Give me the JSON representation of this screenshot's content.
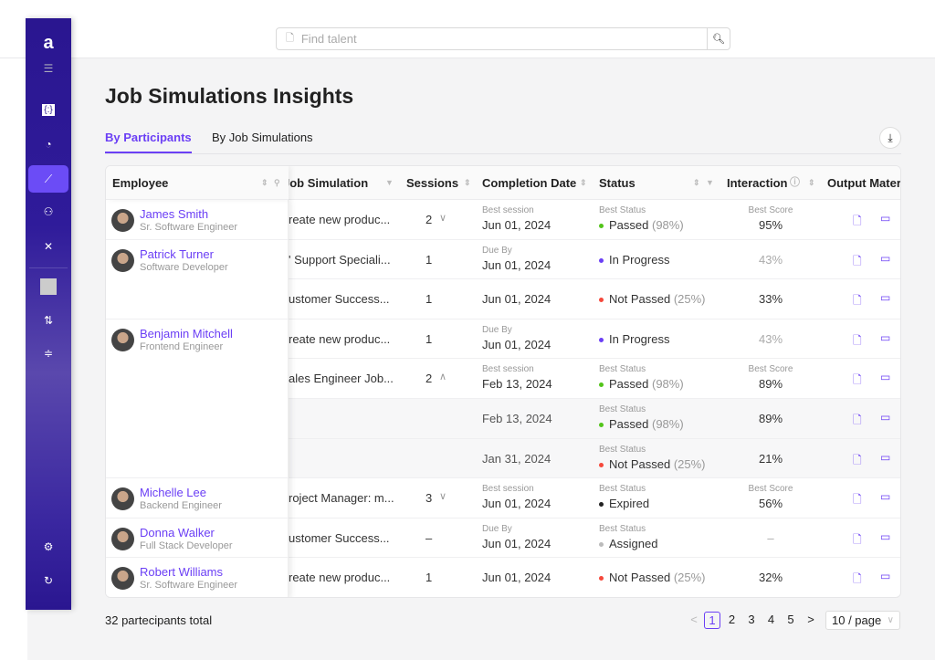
{
  "header": {
    "search_placeholder": "Find talent"
  },
  "sidebar": {
    "items": [
      "logo",
      "menu-toggle",
      "brackets-app",
      "pie-chart",
      "insights",
      "users",
      "tools",
      "avatar",
      "routes",
      "list",
      "settings",
      "logout"
    ],
    "active": "insights"
  },
  "page": {
    "title": "Job Simulations Insights",
    "tabs": [
      "By Participants",
      "By Job Simulations"
    ],
    "active_tab": "By Participants"
  },
  "columns": [
    "Employee",
    "Job Simulation",
    "Sessions",
    "Completion Date",
    "Status",
    "Interaction",
    "Output Materi"
  ],
  "colors": {
    "accent": "#6b3ff5",
    "passed": "#52c41a",
    "in_progress": "#6b3ff5",
    "not_passed": "#f5483b",
    "expired": "#222222",
    "assigned": "#bbbbbb"
  },
  "employees": [
    {
      "name": "James Smith",
      "role": "Sr. Software Engineer"
    },
    {
      "name": "Patrick Turner",
      "role": "Software Developer"
    },
    {
      "name": "Benjamin Mitchell",
      "role": "Frontend Engineer"
    },
    {
      "name": "Michelle Lee",
      "role": "Backend Engineer"
    },
    {
      "name": "Donna Walker",
      "role": "Full Stack Developer"
    },
    {
      "name": "Robert Williams",
      "role": "Sr. Software Engineer"
    }
  ],
  "rows": [
    {
      "sim": "reate new produc...",
      "sessions": "2",
      "chev": "∨",
      "date_label": "Best session",
      "date": "Jun 01, 2024",
      "status_label": "Best Status",
      "status": "Passed",
      "status_key": "passed",
      "pct": "(98%)",
      "score_label": "Best Score",
      "score": "95%",
      "score_muted": false
    },
    {
      "sim": "' Support Speciali...",
      "sessions": "1",
      "chev": "",
      "date_label": "Due By",
      "date": "Jun 01, 2024",
      "status_label": "",
      "status": "In Progress",
      "status_key": "in_progress",
      "pct": "",
      "score_label": "",
      "score": "43%",
      "score_muted": true
    },
    {
      "sim": "ustomer Success...",
      "sessions": "1",
      "chev": "",
      "date_label": "",
      "date": "Jun 01, 2024",
      "status_label": "",
      "status": "Not Passed",
      "status_key": "not_passed",
      "pct": "(25%)",
      "score_label": "",
      "score": "33%",
      "score_muted": false
    },
    {
      "sim": "reate new produc...",
      "sessions": "1",
      "chev": "",
      "date_label": "Due By",
      "date": "Jun 01, 2024",
      "status_label": "",
      "status": "In Progress",
      "status_key": "in_progress",
      "pct": "",
      "score_label": "",
      "score": "43%",
      "score_muted": true
    },
    {
      "sim": "ales Engineer Job...",
      "sessions": "2",
      "chev": "∧",
      "date_label": "Best session",
      "date": "Feb 13, 2024",
      "status_label": "Best Status",
      "status": "Passed",
      "status_key": "passed",
      "pct": "(98%)",
      "score_label": "Best Score",
      "score": "89%",
      "score_muted": false
    },
    {
      "sub": true,
      "sim": "",
      "sessions": "",
      "chev": "",
      "date_label": "",
      "date": "Feb 13, 2024",
      "status_label": "Best Status",
      "status": "Passed",
      "status_key": "passed",
      "pct": "(98%)",
      "score_label": "",
      "score": "89%",
      "score_muted": false
    },
    {
      "sub": true,
      "sim": "",
      "sessions": "",
      "chev": "",
      "date_label": "",
      "date": "Jan 31, 2024",
      "status_label": "Best Status",
      "status": "Not Passed",
      "status_key": "not_passed",
      "pct": "(25%)",
      "score_label": "",
      "score": "21%",
      "score_muted": false
    },
    {
      "sim": "roject Manager: m...",
      "sessions": "3",
      "chev": "∨",
      "date_label": "Best session",
      "date": "Jun 01, 2024",
      "status_label": "Best Status",
      "status": "Expired",
      "status_key": "expired",
      "pct": "",
      "score_label": "Best Score",
      "score": "56%",
      "score_muted": false
    },
    {
      "sim": "ustomer Success...",
      "sessions": "–",
      "chev": "",
      "date_label": "Due By",
      "date": "Jun 01, 2024",
      "status_label": "Best Status",
      "status": "Assigned",
      "status_key": "assigned",
      "pct": "",
      "score_label": "",
      "score": "–",
      "score_muted": true
    },
    {
      "sim": "reate new produc...",
      "sessions": "1",
      "chev": "",
      "date_label": "",
      "date": "Jun 01, 2024",
      "status_label": "",
      "status": "Not Passed",
      "status_key": "not_passed",
      "pct": "(25%)",
      "score_label": "",
      "score": "32%",
      "score_muted": false
    }
  ],
  "employee_rows": [
    [
      0,
      1
    ],
    [
      1,
      2
    ],
    [
      3,
      4
    ],
    [
      7,
      1
    ],
    [
      8,
      1
    ],
    [
      9,
      1
    ]
  ],
  "footer": {
    "total": "32 partecipants total",
    "pages": [
      "1",
      "2",
      "3",
      "4",
      "5"
    ],
    "current_page": "1",
    "page_size": "10 / page",
    "prev": "<",
    "next": ">"
  }
}
